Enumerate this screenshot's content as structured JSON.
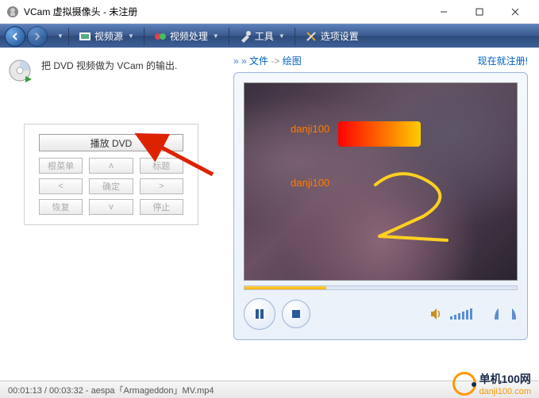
{
  "window": {
    "title": "VCam 虚拟摄像头 - 未注册"
  },
  "toolbar": {
    "video_source": "视频源",
    "video_process": "视频处理",
    "tools": "工具",
    "options": "选项设置"
  },
  "left": {
    "description": "把 DVD 视频做为 VCam 的输出.",
    "play_dvd": "播放 DVD",
    "buttons": {
      "root_menu": "根菜单",
      "up": "ᴧ",
      "title_btn": "标题",
      "left": "<",
      "ok": "确定",
      "right": ">",
      "resume": "恢复",
      "down": "v",
      "stop": "停止"
    }
  },
  "breadcrumb": {
    "chevrons": "» »",
    "file": "文件",
    "arrow": "->",
    "draw": "绘图",
    "register": "现在就注册!"
  },
  "video": {
    "watermark1": "danji100",
    "watermark2": "danji100"
  },
  "status": {
    "text": "00:01:13 / 00:03:32 - aespa「Armageddon」MV.mp4"
  },
  "footer": {
    "brand": "单机100网",
    "domain": "danji100.com"
  }
}
